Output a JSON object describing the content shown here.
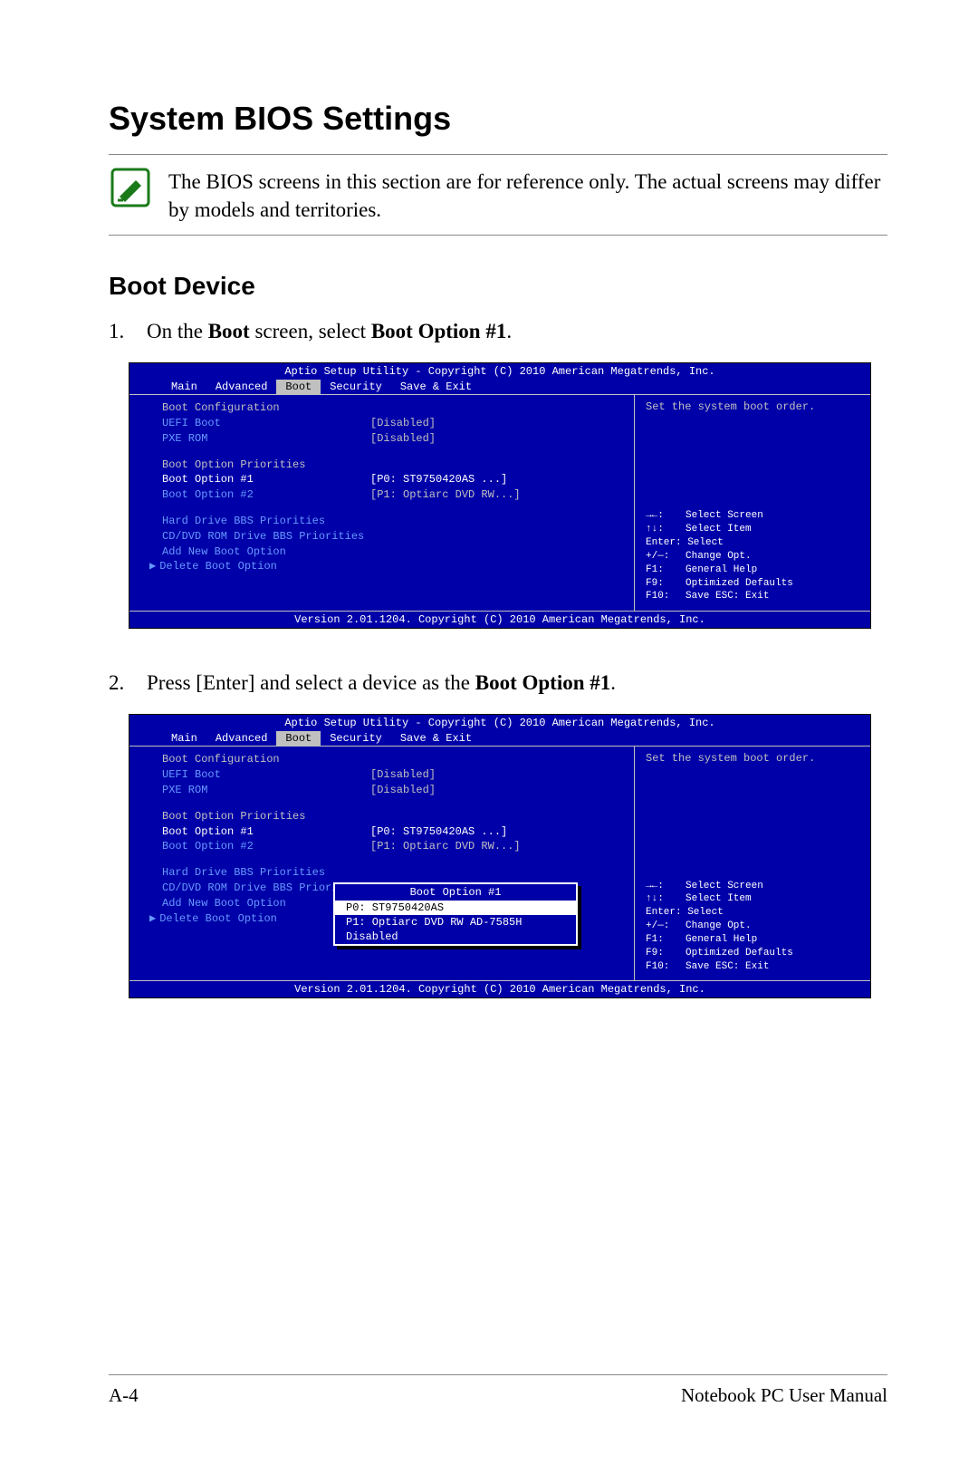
{
  "page": {
    "title": "System BIOS Settings",
    "note": "The BIOS screens in this section are for reference only. The actual screens may differ by models and territories.",
    "section_heading": "Boot Device",
    "footer_left": "A-4",
    "footer_right": "Notebook PC User Manual"
  },
  "steps": {
    "s1_num": "1.",
    "s1_a": "On the ",
    "s1_b1": "Boot",
    "s1_c": " screen, select ",
    "s1_b2": "Boot Option #1",
    "s1_d": ".",
    "s2_num": "2.",
    "s2_a": "Press [Enter] and select a device as the ",
    "s2_b1": "Boot Option #1",
    "s2_c": "."
  },
  "bios": {
    "header": "Aptio Setup Utility - Copyright (C) 2010 American Megatrends, Inc.",
    "menu": {
      "main": "Main",
      "advanced": "Advanced",
      "boot": "Boot",
      "security": "Security",
      "save": "Save & Exit"
    },
    "groups": {
      "boot_config": "Boot Configuration",
      "uefi_label": "UEFI Boot",
      "uefi_val": "[Disabled]",
      "pxe_label": "PXE ROM",
      "pxe_val": "[Disabled]",
      "priorities": "Boot Option Priorities",
      "bo1_label": "Boot Option #1",
      "bo1_val": "[P0: ST9750420AS ...]",
      "bo2_label": "Boot Option #2",
      "bo2_val": "[P1: Optiarc DVD RW...]",
      "hd_bbs": "Hard Drive BBS Priorities",
      "cd_bbs": "CD/DVD ROM Drive BBS Priorities",
      "add_boot": "Add New Boot Option",
      "del_boot": "Delete Boot Option"
    },
    "help_top": "Set the system boot order.",
    "hints": {
      "sel_screen": "Select Screen",
      "sel_item": "Select Item",
      "enter": "Enter: Select",
      "change": "Change Opt.",
      "f1": "General Help",
      "f9": "Optimized Defaults",
      "f10": "Save   ESC: Exit",
      "arrows_lr": "→←:",
      "arrows_ud": "↑↓:",
      "plusminus": "+/—:",
      "f1k": "F1:",
      "f9k": "F9:",
      "f10k": "F10:"
    },
    "footer": "Version 2.01.1204. Copyright (C) 2010 American Megatrends, Inc."
  },
  "popup": {
    "title": "Boot Option #1",
    "opt1": "P0: ST9750420AS",
    "opt2": "P1: Optiarc DVD RW AD-7585H",
    "opt3": "Disabled"
  }
}
